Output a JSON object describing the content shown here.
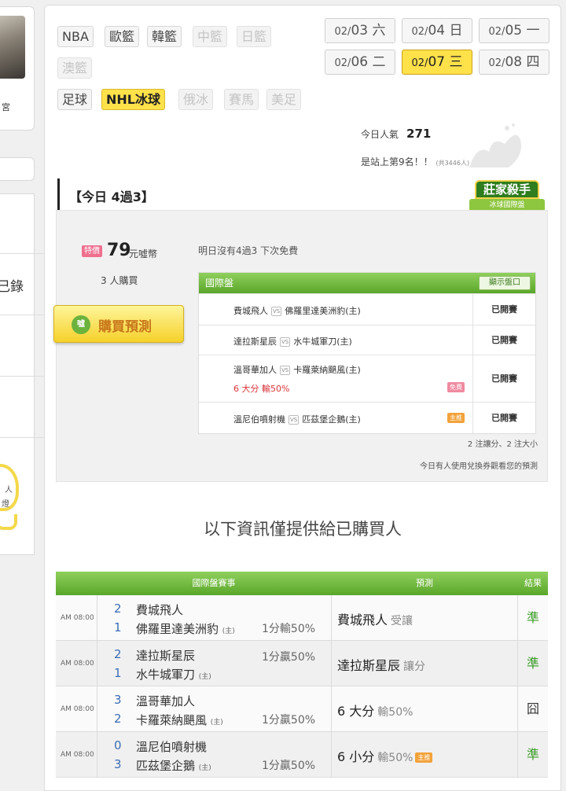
{
  "left": {
    "palace_label": "宮",
    "record_label": "己錄",
    "bulb_text1": "人",
    "bulb_text2": "燈"
  },
  "categories": [
    {
      "label": "NBA",
      "state": "normal"
    },
    {
      "label": "歐籃",
      "state": "normal"
    },
    {
      "label": "韓籃",
      "state": "normal"
    },
    {
      "label": "中籃",
      "state": "dim"
    },
    {
      "label": "日籃",
      "state": "dim"
    },
    {
      "label": "澳籃",
      "state": "dim"
    },
    {
      "label": "足球",
      "state": "normal"
    },
    {
      "label": "NHL冰球",
      "state": "active"
    },
    {
      "label": "俄冰",
      "state": "dim"
    },
    {
      "label": "賽馬",
      "state": "dim"
    },
    {
      "label": "美足",
      "state": "dim"
    }
  ],
  "dates": [
    {
      "prefix": "02/",
      "day": "03",
      "weekday": "六",
      "active": false
    },
    {
      "prefix": "02/",
      "day": "04",
      "weekday": "日",
      "active": false
    },
    {
      "prefix": "02/",
      "day": "05",
      "weekday": "一",
      "active": false
    },
    {
      "prefix": "02/",
      "day": "06",
      "weekday": "二",
      "active": false
    },
    {
      "prefix": "02/",
      "day": "07",
      "weekday": "三",
      "active": true
    },
    {
      "prefix": "02/",
      "day": "08",
      "weekday": "四",
      "active": false
    }
  ],
  "stats": {
    "popularity_label": "今日人氣",
    "popularity_value": "271",
    "rank_text": "是站上第9名！！",
    "rank_total": "(共3446人)"
  },
  "today": {
    "title": "【今日 4過3】",
    "badge_top": "莊家殺手",
    "badge_bottom": "冰球國際盤",
    "price_tag": "特價",
    "price": "79",
    "price_unit": "元噓幣",
    "buyers": "3 人購買",
    "next_note": "明日沒有4過3 下次免費",
    "buy_label": "購買預測",
    "buy_icon": "噓",
    "intl_title": "國際盤",
    "show_button": "顯示盤口",
    "games": [
      {
        "away": "費城飛人",
        "home": "佛羅里達美洲豹(主)",
        "extra": "",
        "pill": "",
        "status": "已開賽"
      },
      {
        "away": "達拉斯星辰",
        "home": "水牛城軍刀(主)",
        "extra": "",
        "pill": "",
        "status": "已開賽"
      },
      {
        "away": "溫哥華加人",
        "home": "卡羅萊納颶風(主)",
        "extra": "6 大分 輸50%",
        "pill": "免費",
        "status": "已開賽"
      },
      {
        "away": "溫尼伯噴射機",
        "home": "匹茲堡企鵝(主)",
        "extra": "",
        "pill": "主推",
        "status": "已開賽"
      }
    ],
    "summary_note": "2 注讓分、2 注大小",
    "coupon_note": "今日有人使用兌換券觀看您的預測"
  },
  "buyers_only_heading": "以下資訊僅提供給已購買人",
  "results_table": {
    "headers": {
      "match": "國際盤賽事",
      "prediction": "預測",
      "result": "結果"
    },
    "host_tag": "(主)",
    "rows": [
      {
        "time": "AM 08:00",
        "score1": "2",
        "team1": "費城飛人",
        "score2": "1",
        "team2": "佛羅里達美洲豹",
        "line_pos": "bottom",
        "line": "1分輸50%",
        "pick": "費城飛人",
        "pick_note": "受讓",
        "pick_tag": "",
        "verdict": "準"
      },
      {
        "time": "AM 08:00",
        "score1": "2",
        "team1": "達拉斯星辰",
        "score2": "1",
        "team2": "水牛城軍刀",
        "line_pos": "top",
        "line": "1分贏50%",
        "pick": "達拉斯星辰",
        "pick_note": "讓分",
        "pick_tag": "",
        "verdict": "準"
      },
      {
        "time": "AM 08:00",
        "score1": "3",
        "team1": "溫哥華加人",
        "score2": "2",
        "team2": "卡羅萊納颶風",
        "line_pos": "bottom",
        "line": "1分贏50%",
        "pick": "6 大分",
        "pick_note": "輸50%",
        "pick_tag": "",
        "verdict": "囧"
      },
      {
        "time": "AM 08:00",
        "score1": "0",
        "team1": "溫尼伯噴射機",
        "score2": "3",
        "team2": "匹茲堡企鵝",
        "line_pos": "bottom",
        "line": "1分贏50%",
        "pick": "6 小分",
        "pick_note": "輸50%",
        "pick_tag": "主推",
        "verdict": "準"
      }
    ]
  },
  "colors": {
    "accent_yellow": "#ffe14a",
    "header_green": "#5aa62a",
    "win_green": "#3c9c2a"
  }
}
